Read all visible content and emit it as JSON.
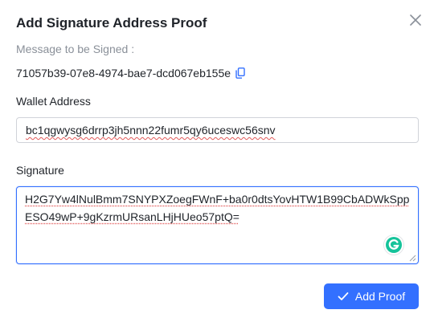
{
  "dialog": {
    "title": "Add Signature Address Proof",
    "close_icon": "close-icon"
  },
  "message": {
    "label": "Message to be Signed :",
    "value": "71057b39-07e8-4974-bae7-dcd067eb155e",
    "copy_icon": "copy-icon"
  },
  "wallet": {
    "label": "Wallet Address",
    "value": "bc1qgwysg6drrp3jh5nnn22fumr5qy6uceswc56snv"
  },
  "signature": {
    "label": "Signature",
    "value": "H2G7Yw4lNulBmm7SNYPXZoegFWnF+ba0r0dtsYovHTW1B99CbADWkSppESO49wP+9gKzrmURsanLHjHUeo57ptQ=",
    "grammarly_icon": "grammarly-icon"
  },
  "actions": {
    "add_proof_label": "Add Proof",
    "add_proof_icon": "check-icon"
  },
  "colors": {
    "accent": "#3370ff",
    "muted_text": "#8a9099",
    "border": "#d0d3d9",
    "spellcheck": "#e25a5a",
    "grammarly": "#15c39a"
  }
}
